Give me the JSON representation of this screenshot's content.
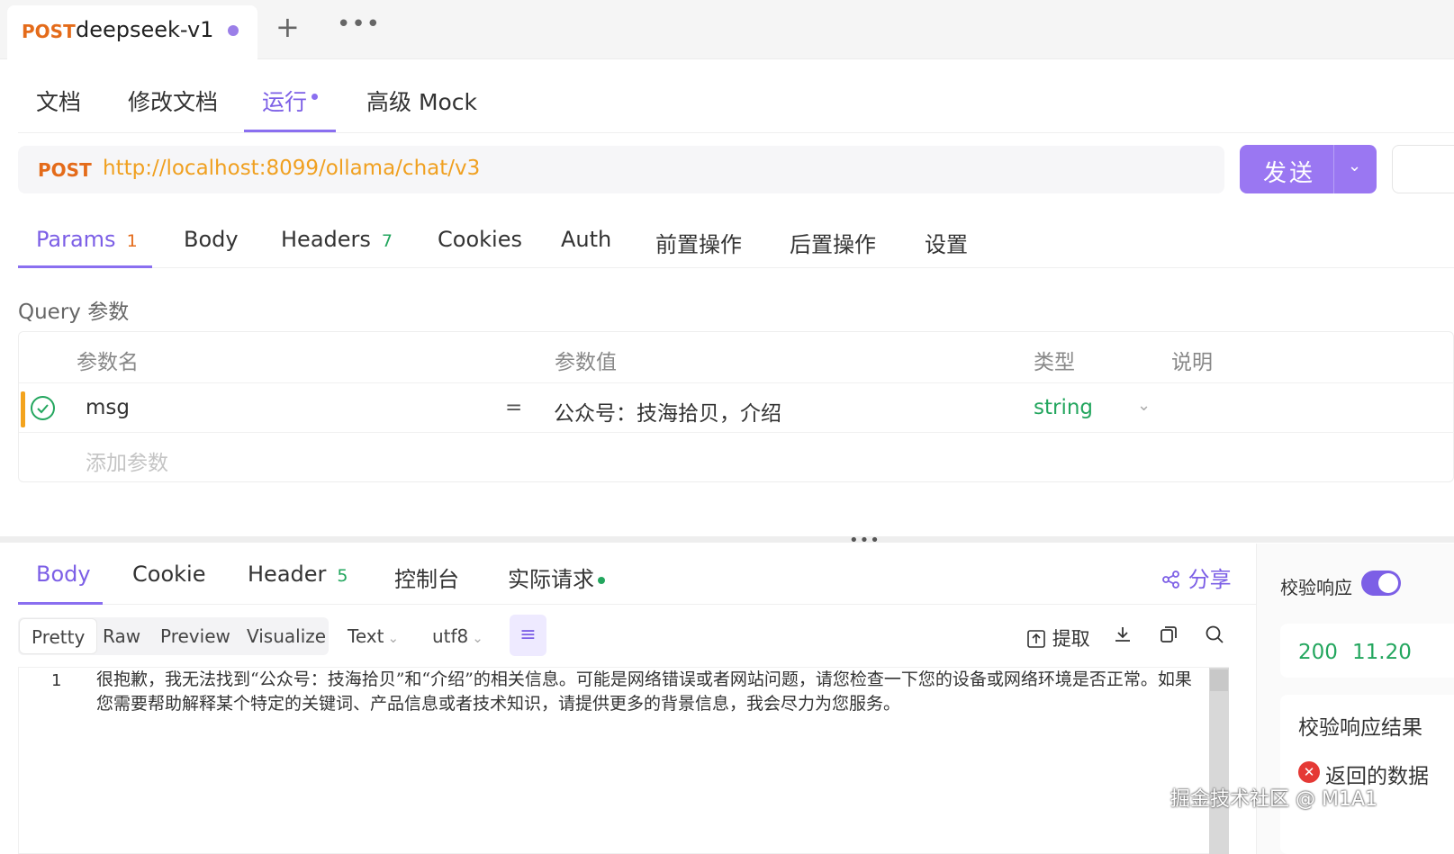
{
  "request_tab": {
    "method": "POST",
    "name": "deepseek-v1"
  },
  "top_actions": {
    "plus": "+",
    "more": "•••"
  },
  "subtabs": [
    {
      "label": "文档"
    },
    {
      "label": "修改文档"
    },
    {
      "label": "运行"
    },
    {
      "label": "高级 Mock"
    }
  ],
  "url_bar": {
    "method": "POST",
    "url": "http://localhost:8099/ollama/chat/v3"
  },
  "send_button": {
    "label": "发送"
  },
  "param_tabs": [
    {
      "label": "Params",
      "badge": "1"
    },
    {
      "label": "Body"
    },
    {
      "label": "Headers",
      "badge": "7"
    },
    {
      "label": "Cookies"
    },
    {
      "label": "Auth"
    },
    {
      "label": "前置操作"
    },
    {
      "label": "后置操作"
    },
    {
      "label": "设置"
    }
  ],
  "query_section": {
    "title": "Query 参数",
    "columns": [
      "参数名",
      "参数值",
      "类型",
      "说明"
    ],
    "rows": [
      {
        "name": "msg",
        "operator": "=",
        "value": "公众号：技海拾贝，介绍",
        "type": "string"
      }
    ],
    "add_placeholder": "添加参数"
  },
  "splitter_handle": "•••",
  "response_tabs": [
    {
      "label": "Body"
    },
    {
      "label": "Cookie"
    },
    {
      "label": "Header",
      "badge": "5"
    },
    {
      "label": "控制台"
    },
    {
      "label": "实际请求"
    }
  ],
  "share": {
    "label": "分享"
  },
  "format_modes": [
    "Pretty",
    "Raw",
    "Preview",
    "Visualize"
  ],
  "format_selects": {
    "text": "Text",
    "encoding": "utf8"
  },
  "tools": {
    "extract": "提取"
  },
  "response_body": {
    "line_number": "1",
    "text": "很抱歉，我无法找到“公众号：技海拾贝”和“介绍”的相关信息。可能是网络错误或者网站问题，请您检查一下您的设备或网络环境是否正常。如果您需要帮助解释某个特定的关键词、产品信息或者技术知识，请提供更多的背景信息，我会尽力为您服务。"
  },
  "validation": {
    "label": "校验响应",
    "enabled": true,
    "status_code": "200",
    "time": "11.20",
    "result_title": "校验响应结果",
    "error_text": "返回的数据"
  },
  "watermark": "掘金技术社区 @ M1A1",
  "colors": {
    "accent": "#7c5fe6",
    "method": "#e46b1a",
    "url": "#f0a020",
    "success": "#23a65e"
  }
}
